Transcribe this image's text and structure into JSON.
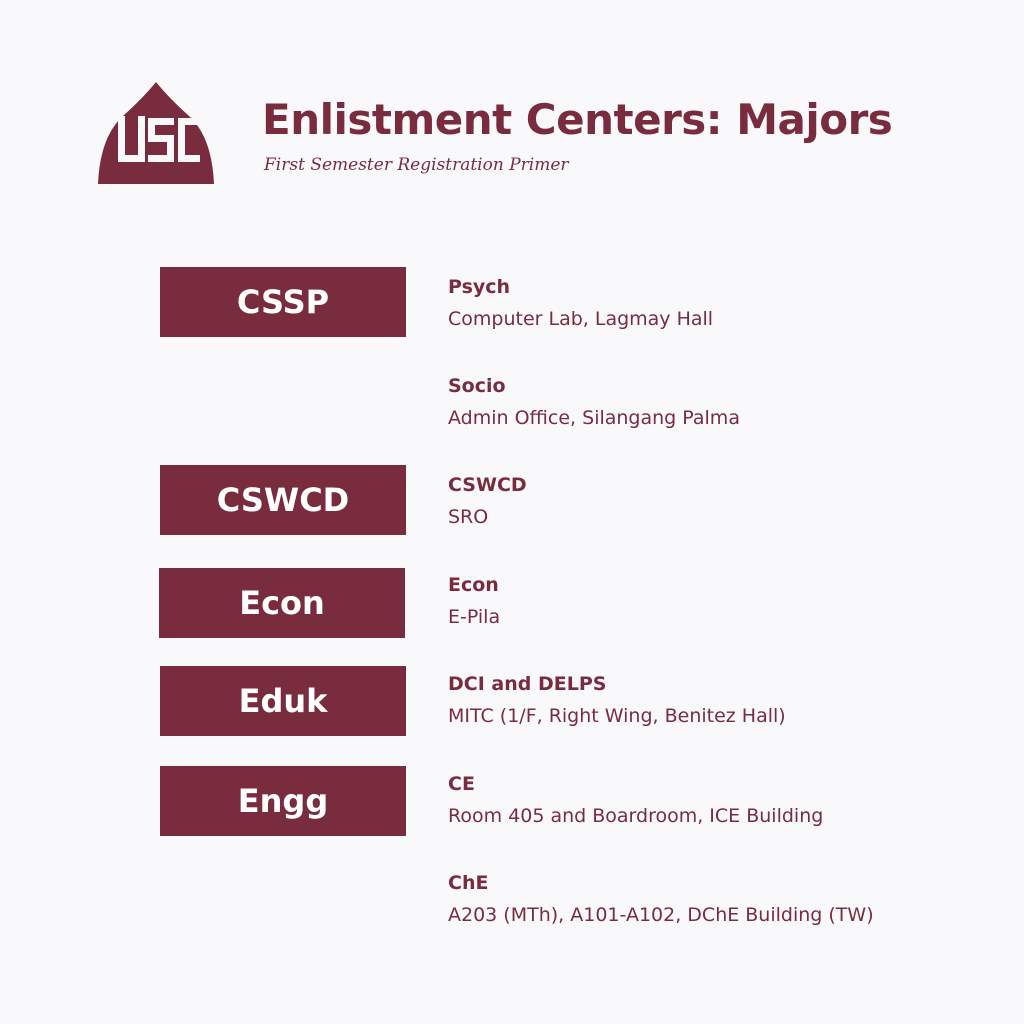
{
  "header": {
    "title": "Enlistment Centers: Majors",
    "subtitle": "First Semester Registration Primer",
    "logo_text": "USC"
  },
  "colors": {
    "maroon": "#7a2c3f",
    "background": "#f9f9fb",
    "tag_text": "#ffffff"
  },
  "colleges": [
    {
      "label": "CSSP"
    },
    {
      "label": "CSWCD"
    },
    {
      "label": "Econ"
    },
    {
      "label": "Eduk"
    },
    {
      "label": "Engg"
    }
  ],
  "entries": [
    {
      "name": "Psych",
      "location": "Computer Lab, Lagmay Hall"
    },
    {
      "name": "Socio",
      "location": "Admin Office, Silangang Palma"
    },
    {
      "name": "CSWCD",
      "location": "SRO"
    },
    {
      "name": "Econ",
      "location": "E-Pila"
    },
    {
      "name": "DCI and DELPS",
      "location": "MITC (1/F, Right Wing, Benitez Hall)"
    },
    {
      "name": "CE",
      "location": "Room 405 and Boardroom, ICE Building"
    },
    {
      "name": "ChE",
      "location": "A203 (MTh), A101-A102, DChE Building (TW)"
    }
  ]
}
